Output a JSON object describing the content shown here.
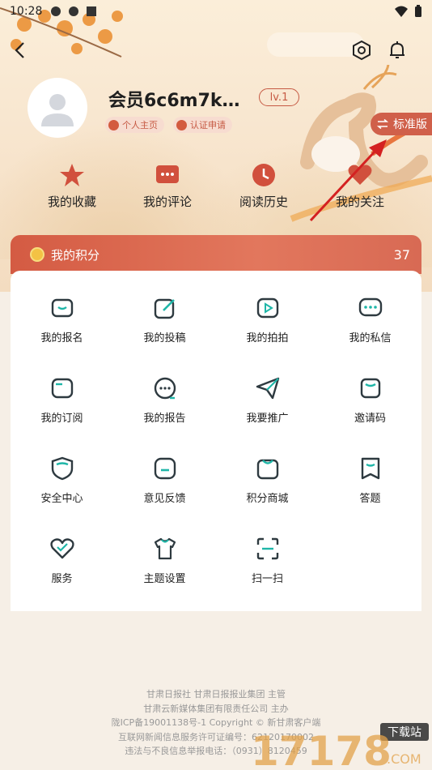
{
  "status_bar": {
    "time": "10:28"
  },
  "profile": {
    "username": "会员6c6m7k…",
    "level": "lv.1",
    "tags": [
      "个人主页",
      "认证申请"
    ]
  },
  "switch_label": "标准版",
  "quick_actions": [
    "我的收藏",
    "我的评论",
    "阅读历史",
    "我的关注"
  ],
  "points": {
    "label": "我的积分",
    "value": "37"
  },
  "grid_items": [
    {
      "label": "我的报名",
      "icon": "screen-icon"
    },
    {
      "label": "我的投稿",
      "icon": "edit-icon"
    },
    {
      "label": "我的拍拍",
      "icon": "play-icon"
    },
    {
      "label": "我的私信",
      "icon": "chat-icon"
    },
    {
      "label": "我的订阅",
      "icon": "subscribe-icon"
    },
    {
      "label": "我的报告",
      "icon": "report-icon"
    },
    {
      "label": "我要推广",
      "icon": "send-icon"
    },
    {
      "label": "邀请码",
      "icon": "invite-icon"
    },
    {
      "label": "安全中心",
      "icon": "shield-icon"
    },
    {
      "label": "意见反馈",
      "icon": "feedback-icon"
    },
    {
      "label": "积分商城",
      "icon": "shop-icon"
    },
    {
      "label": "答题",
      "icon": "quiz-icon"
    },
    {
      "label": "服务",
      "icon": "heart-icon"
    },
    {
      "label": "主题设置",
      "icon": "shirt-icon"
    },
    {
      "label": "扫一扫",
      "icon": "scan-icon"
    }
  ],
  "footer": [
    "甘肃日报社 甘肃日报报业集团 主管",
    "甘肃云新媒体集团有限责任公司 主办",
    "陇ICP备19001138号-1  Copyright © 新甘肃客户端",
    "互联网新闻信息服务许可证编号：62120170002",
    "违法与不良信息举报电话：（0931）8120459"
  ],
  "watermark": {
    "text": "下载站",
    "brand": "17178.COM"
  },
  "colors": {
    "accent": "#d0604a",
    "icon": "#2e3a40",
    "icon_accent": "#1fb6a8"
  }
}
